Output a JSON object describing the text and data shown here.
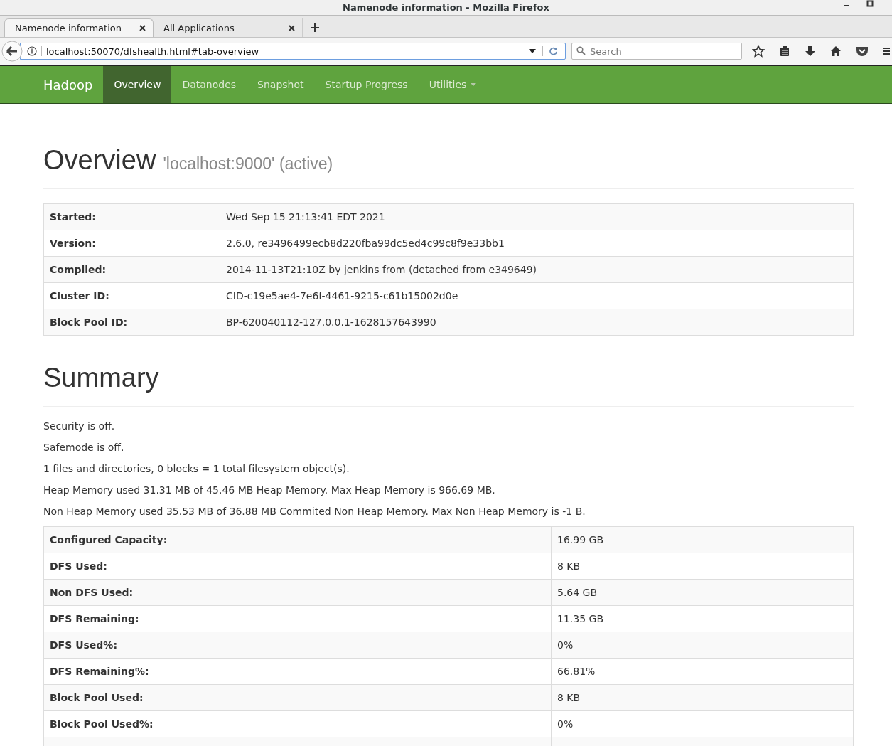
{
  "window": {
    "title": "Namenode information - Mozilla Firefox"
  },
  "tabs": [
    {
      "label": "Namenode information",
      "selected": true
    },
    {
      "label": "All Applications",
      "selected": false
    }
  ],
  "address_bar": {
    "value": "localhost:50070/dfshealth.html#tab-overview"
  },
  "search": {
    "placeholder": "Search"
  },
  "navbar": {
    "brand": "Hadoop",
    "items": [
      {
        "label": "Overview",
        "selected": true,
        "dropdown": false
      },
      {
        "label": "Datanodes",
        "selected": false,
        "dropdown": false
      },
      {
        "label": "Snapshot",
        "selected": false,
        "dropdown": false
      },
      {
        "label": "Startup Progress",
        "selected": false,
        "dropdown": false
      },
      {
        "label": "Utilities",
        "selected": false,
        "dropdown": true
      }
    ]
  },
  "overview": {
    "title": "Overview",
    "subtitle": "'localhost:9000' (active)",
    "rows": [
      {
        "label": "Started:",
        "value": "Wed Sep 15 21:13:41 EDT 2021"
      },
      {
        "label": "Version:",
        "value": "2.6.0, re3496499ecb8d220fba99dc5ed4c99c8f9e33bb1"
      },
      {
        "label": "Compiled:",
        "value": "2014-11-13T21:10Z by jenkins from (detached from e349649)"
      },
      {
        "label": "Cluster ID:",
        "value": "CID-c19e5ae4-7e6f-4461-9215-c61b15002d0e"
      },
      {
        "label": "Block Pool ID:",
        "value": "BP-620040112-127.0.0.1-1628157643990"
      }
    ]
  },
  "summary": {
    "title": "Summary",
    "lines": [
      "Security is off.",
      "Safemode is off.",
      "1 files and directories, 0 blocks = 1 total filesystem object(s).",
      "Heap Memory used 31.31 MB of 45.46 MB Heap Memory. Max Heap Memory is 966.69 MB.",
      "Non Heap Memory used 35.53 MB of 36.88 MB Commited Non Heap Memory. Max Non Heap Memory is -1 B."
    ],
    "rows": [
      {
        "label": "Configured Capacity:",
        "value": "16.99 GB"
      },
      {
        "label": "DFS Used:",
        "value": "8 KB"
      },
      {
        "label": "Non DFS Used:",
        "value": "5.64 GB"
      },
      {
        "label": "DFS Remaining:",
        "value": "11.35 GB"
      },
      {
        "label": "DFS Used%:",
        "value": "0%"
      },
      {
        "label": "DFS Remaining%:",
        "value": "66.81%"
      },
      {
        "label": "Block Pool Used:",
        "value": "8 KB"
      },
      {
        "label": "Block Pool Used%:",
        "value": "0%"
      }
    ]
  }
}
